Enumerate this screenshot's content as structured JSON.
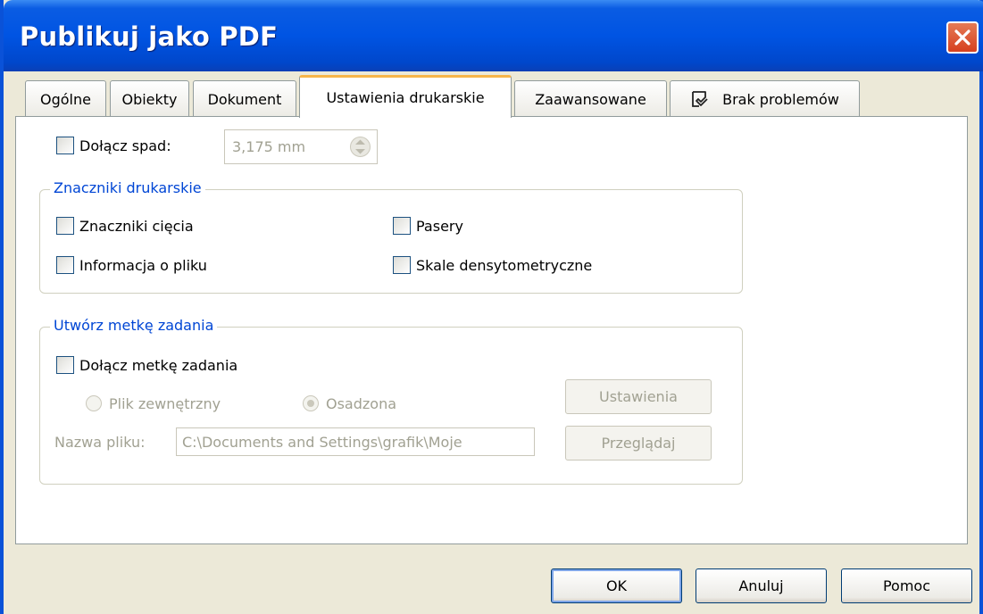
{
  "window": {
    "title": "Publikuj jako PDF"
  },
  "tabs": [
    {
      "label": "Ogólne"
    },
    {
      "label": "Obiekty"
    },
    {
      "label": "Dokument"
    },
    {
      "label": "Ustawienia drukarskie"
    },
    {
      "label": "Zaawansowane"
    },
    {
      "label": "Brak problemów"
    }
  ],
  "active_tab": "Ustawienia drukarskie",
  "bleed": {
    "checkbox_label": "Dołącz spad:",
    "checked": false,
    "value": "3,175 mm"
  },
  "printer_marks": {
    "legend": "Znaczniki drukarskie",
    "crop_marks": "Znaczniki cięcia",
    "file_info": "Informacja o pliku",
    "registration": "Pasery",
    "density_scales": "Skale densytometryczne"
  },
  "job_ticket": {
    "legend": "Utwórz metkę zadania",
    "include_label": "Dołącz metkę zadania",
    "external_file": "Plik zewnętrzny",
    "embedded": "Osadzona",
    "selected": "Osadzona",
    "settings_button": "Ustawienia",
    "filename_label": "Nazwa pliku:",
    "filename_value": "C:\\Documents and Settings\\grafik\\Moje",
    "browse_button": "Przeglądaj"
  },
  "buttons": {
    "ok": "OK",
    "cancel": "Anuluj",
    "help": "Pomoc"
  },
  "colors": {
    "titlebar": "#0054e3",
    "legend_text": "#0046d5",
    "active_tab_accent": "#f7b54a",
    "disabled_text": "#a1a192"
  }
}
